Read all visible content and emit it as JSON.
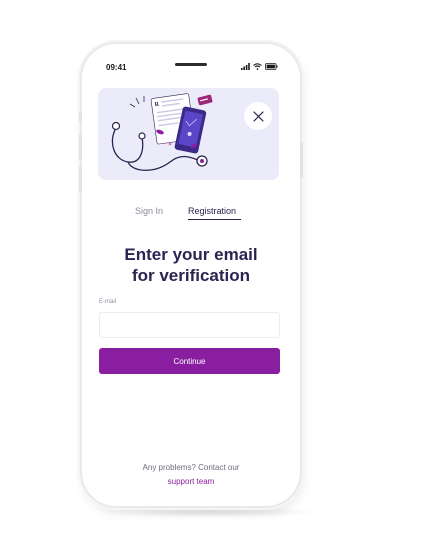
{
  "status_bar": {
    "time": "09:41"
  },
  "tabs": [
    {
      "label": "Sign In",
      "active": false
    },
    {
      "label": "Registration",
      "active": true
    }
  ],
  "heading": {
    "line1": "Enter your email",
    "line2": "for verification"
  },
  "email_field": {
    "label": "E-mail",
    "value": "",
    "placeholder": ""
  },
  "continue_label": "Continue",
  "footer": {
    "help_text": "Any problems? Contact our",
    "support_link": "support team"
  },
  "colors": {
    "accent": "#8a1ea0",
    "heading": "#2a2450",
    "hero_bg": "#ecebf9"
  },
  "icons": [
    "stethoscope-illustration",
    "close-icon",
    "signal-icon",
    "wifi-icon",
    "battery-icon"
  ]
}
